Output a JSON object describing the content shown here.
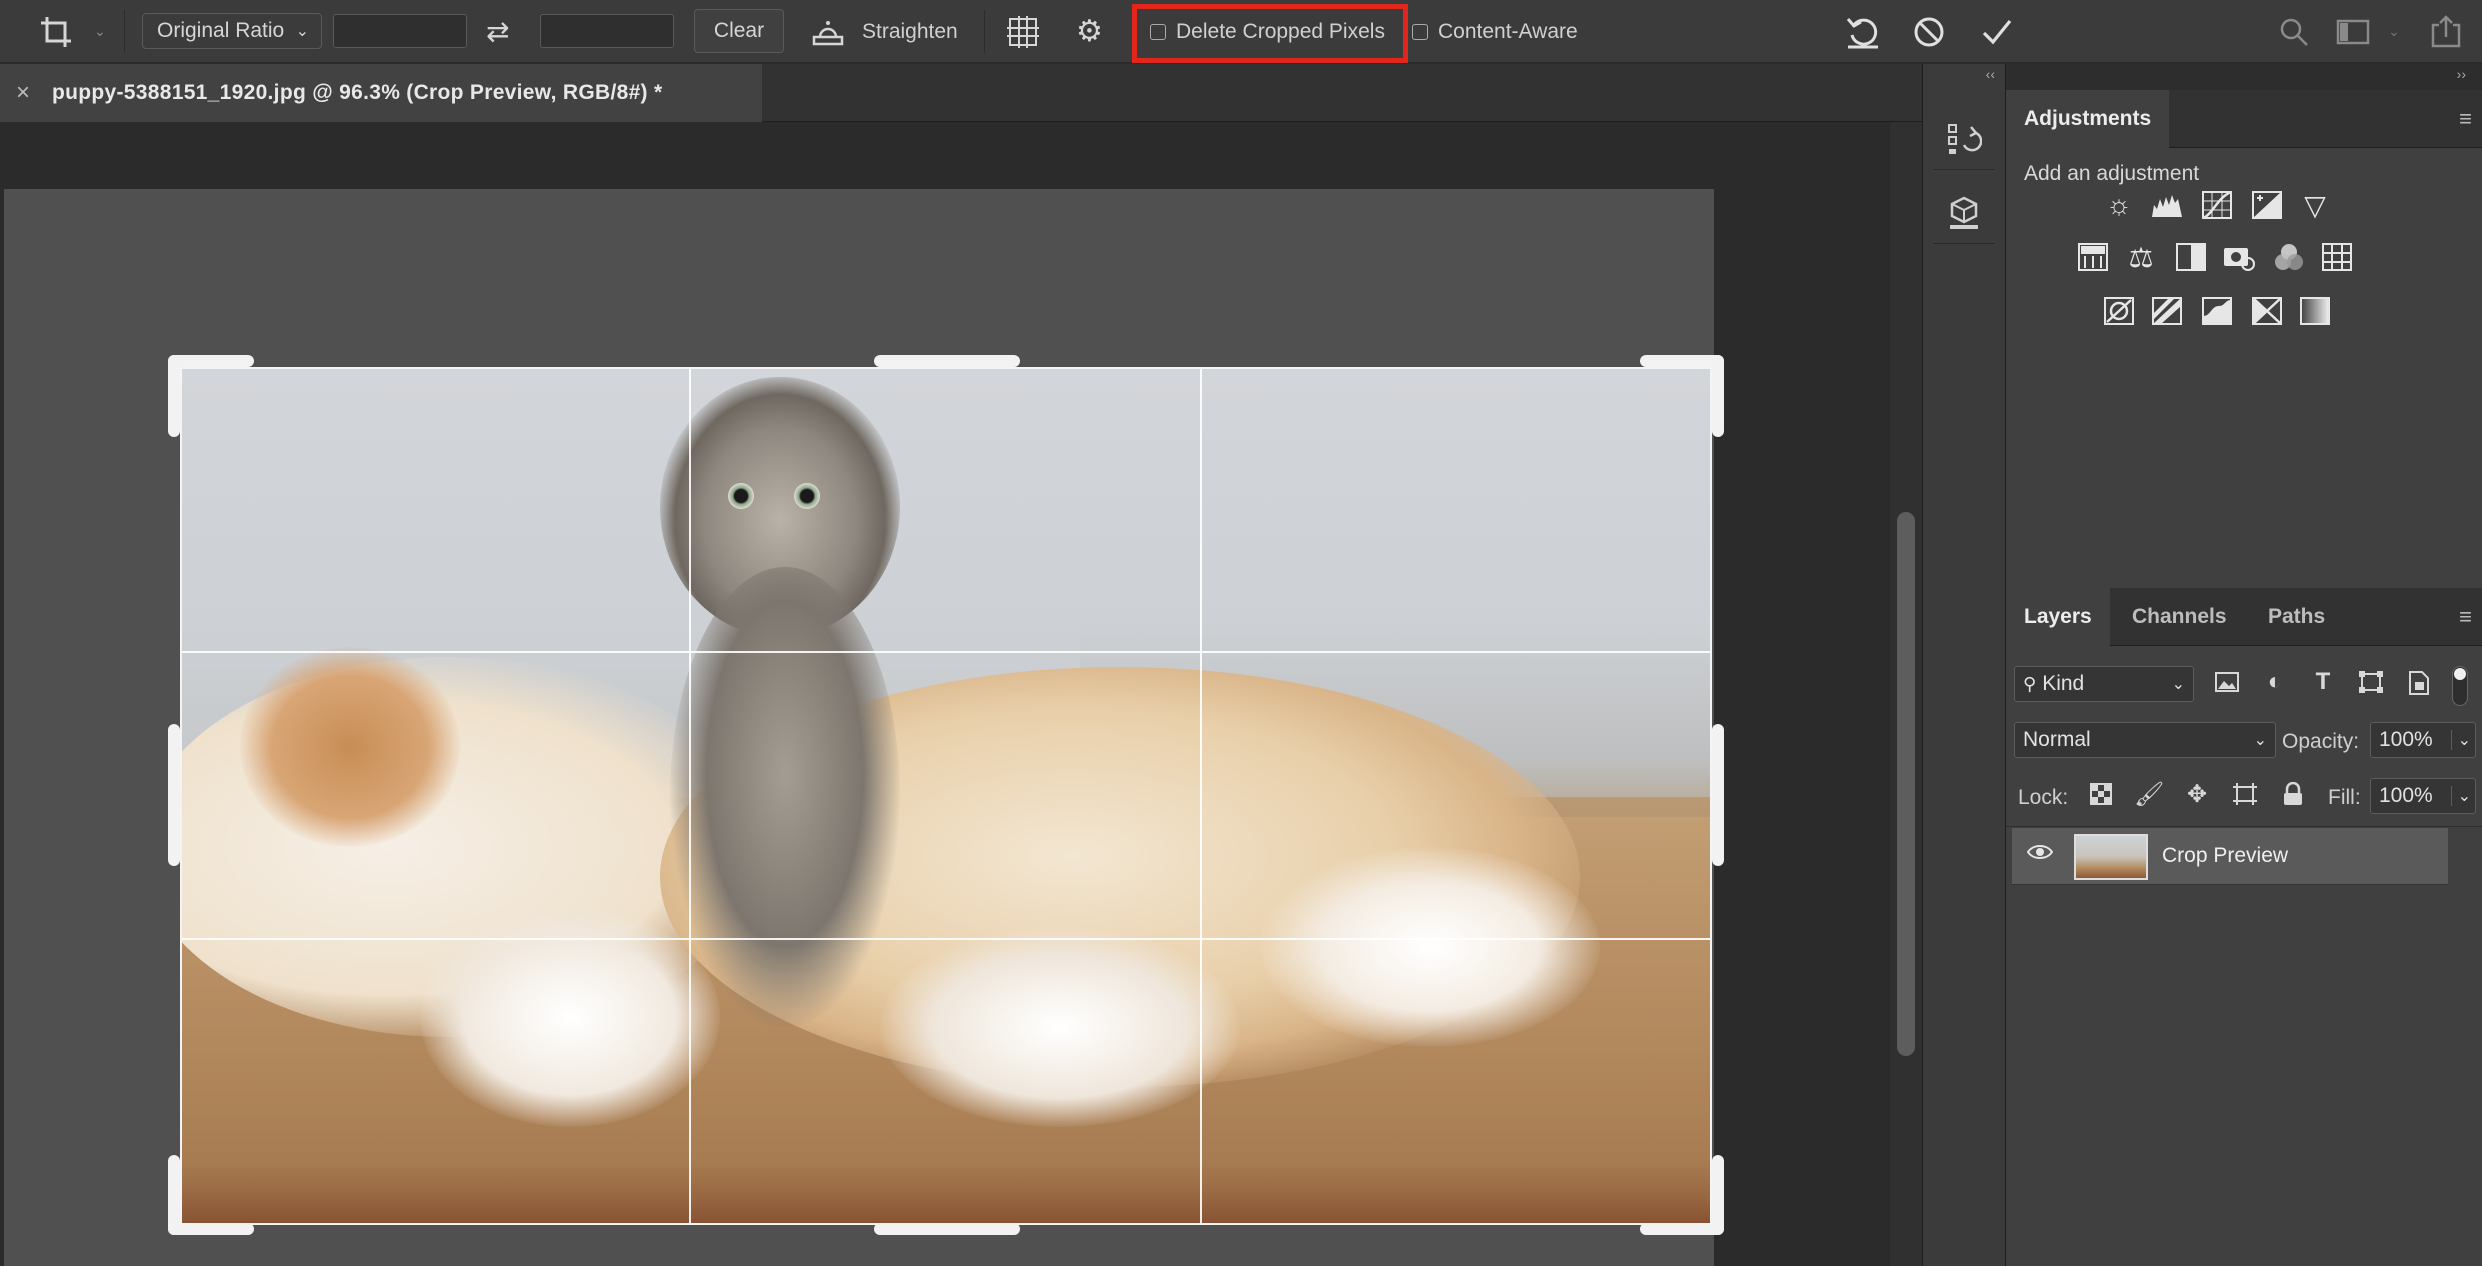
{
  "options_bar": {
    "crop_tool_icon": "crop-icon",
    "ratio_dropdown": "Original Ratio",
    "width_value": "",
    "height_value": "",
    "swap_icon": "swap-arrows-icon",
    "clear_label": "Clear",
    "straighten_icon": "straighten-level-icon",
    "straighten_label": "Straighten",
    "overlay_icon": "grid-overlay-icon",
    "settings_icon": "gear-icon",
    "delete_cropped_label": "Delete Cropped Pixels",
    "delete_cropped_checked": false,
    "content_aware_label": "Content-Aware",
    "content_aware_checked": false,
    "reset_icon": "reset-icon",
    "cancel_icon": "cancel-icon",
    "commit_icon": "checkmark-icon",
    "search_icon": "search-icon",
    "workspace_icon": "workspace-icon",
    "share_icon": "share-icon",
    "highlight_color": "#e1261c"
  },
  "document": {
    "tab_title": "puppy-5388151_1920.jpg @ 96.3% (Crop Preview, RGB/8#) *",
    "close_glyph": "×"
  },
  "panel_strip": {
    "collapse": "‹‹",
    "buttons": [
      "history-icon",
      "3d-properties-icon"
    ]
  },
  "adjustments": {
    "collapse": "››",
    "tab_label": "Adjustments",
    "menu_glyph": "≡",
    "subtitle": "Add an adjustment",
    "icons_row1": [
      "brightness-contrast-icon",
      "levels-icon",
      "curves-icon",
      "exposure-icon",
      "vibrance-icon"
    ],
    "icons_row2": [
      "hue-saturation-icon",
      "color-balance-icon",
      "black-white-icon",
      "photo-filter-icon",
      "channel-mixer-icon",
      "color-lookup-icon"
    ],
    "icons_row3": [
      "invert-icon",
      "posterize-icon",
      "threshold-icon",
      "selective-color-icon",
      "gradient-map-icon"
    ]
  },
  "layers": {
    "tabs": [
      "Layers",
      "Channels",
      "Paths"
    ],
    "active_tab": "Layers",
    "menu_glyph": "≡",
    "filter_kind": "Kind",
    "filter_icons": [
      "pixel-filter-icon",
      "adjustment-filter-icon",
      "type-filter-icon",
      "shape-filter-icon",
      "smart-object-filter-icon"
    ],
    "blend_mode": "Normal",
    "opacity_label": "Opacity:",
    "opacity_value": "100%",
    "lock_label": "Lock:",
    "lock_icons": [
      "lock-transparent-icon",
      "lock-paint-icon",
      "lock-position-icon",
      "lock-artboard-icon",
      "lock-all-icon"
    ],
    "fill_label": "Fill:",
    "fill_value": "100%",
    "layer_items": [
      {
        "name": "Crop Preview",
        "visible": true,
        "selected": true
      }
    ]
  }
}
